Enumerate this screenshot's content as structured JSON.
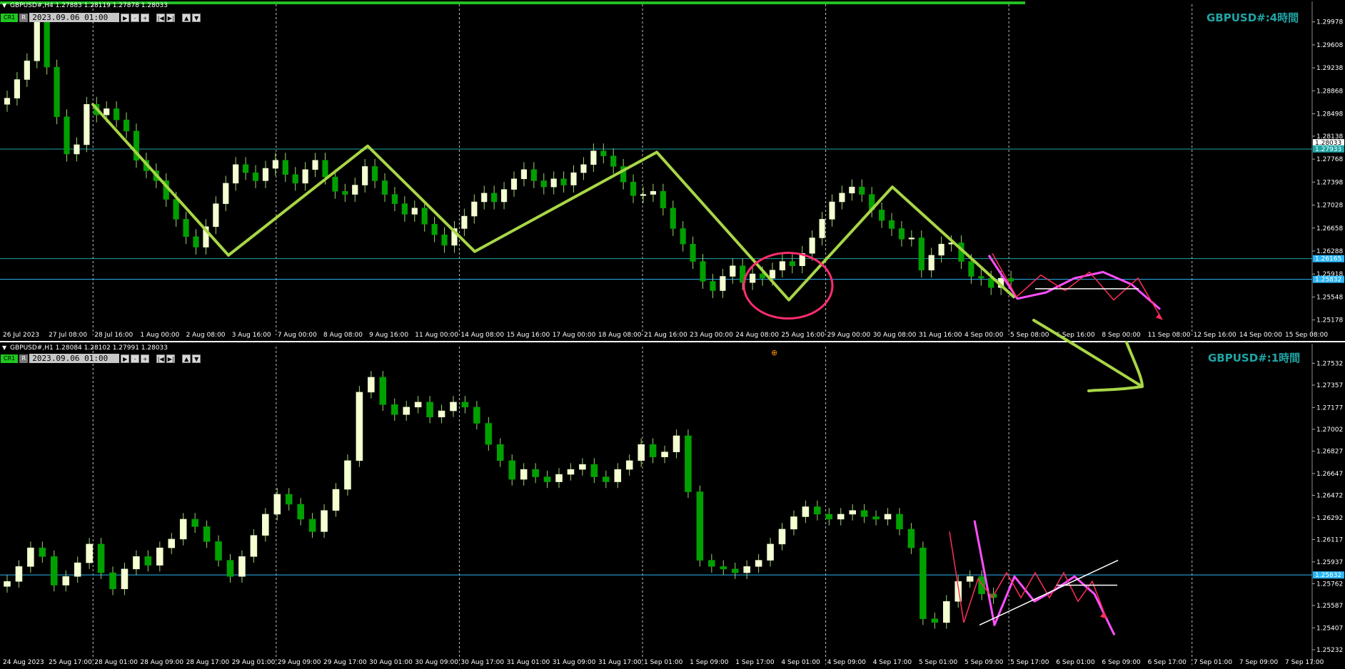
{
  "panel1": {
    "header": "GBPUSD#,H4  1.27883 1.28119 1.27878 1.28033",
    "badge": "CR1",
    "badge_r": "R",
    "datetime": "2023.09.06 01:00",
    "title": "GBPUSD#:4時間"
  },
  "panel2": {
    "header": "GBPUSD#,H1  1.28084 1.28102 1.27991 1.28033",
    "badge": "CR1",
    "badge_r": "R",
    "datetime": "2023.09.06 01:00",
    "title": "GBPUSD#:1時間"
  },
  "controls": {
    "play": "▶",
    "minus": "-",
    "plus": "+",
    "first": "|◀",
    "last": "▶|",
    "up": "▲",
    "down": "▼"
  },
  "colors": {
    "background": "#000000",
    "bull_body": "#f4ffd2",
    "bear_body": "#00a000",
    "wick": "#9bd26e",
    "wave_line": "#a8d646",
    "pink_line": "#ff4fff",
    "red_line": "#ff2d5a",
    "circle": "#ff2d6e",
    "level_line": "#1fa5a5",
    "grid": "#ffffff",
    "top_bar": "#22c022"
  },
  "chart_data": [
    {
      "type": "candlestick",
      "name": "GBPUSD#,H4",
      "timeframe": "H4",
      "x_ticks": [
        "26 Jul 2023",
        "27 Jul 08:00",
        "28 Jul 16:00",
        "1 Aug 00:00",
        "2 Aug 08:00",
        "3 Aug 16:00",
        "7 Aug 00:00",
        "8 Aug 08:00",
        "9 Aug 16:00",
        "11 Aug 00:00",
        "14 Aug 08:00",
        "15 Aug 16:00",
        "17 Aug 00:00",
        "18 Aug 08:00",
        "21 Aug 16:00",
        "23 Aug 00:00",
        "24 Aug 08:00",
        "25 Aug 16:00",
        "29 Aug 00:00",
        "30 Aug 08:00",
        "31 Aug 16:00",
        "4 Sep 00:00",
        "5 Sep 08:00",
        "6 Sep 16:00",
        "8 Sep 00:00",
        "11 Sep 08:00",
        "12 Sep 16:00",
        "14 Sep 00:00",
        "15 Sep 08:00"
      ],
      "y_ticks": [
        "1.29978",
        "1.29608",
        "1.29238",
        "1.28868",
        "1.28498",
        "1.28138",
        "1.27768",
        "1.27398",
        "1.27028",
        "1.26658",
        "1.26288",
        "1.25918",
        "1.25548",
        "1.25178"
      ],
      "ylim": [
        1.2507,
        1.3017
      ],
      "price_labels": [
        "1.28033",
        "1.27933",
        "1.26165",
        "1.25832"
      ],
      "horizontal_levels": [
        1.2793,
        1.26165,
        1.25832
      ],
      "closes": [
        1.2875,
        1.2905,
        1.2935,
        1.2998,
        1.2925,
        1.2845,
        1.2785,
        1.28,
        1.2865,
        1.2848,
        1.2858,
        1.284,
        1.2822,
        1.2775,
        1.2758,
        1.2742,
        1.2712,
        1.268,
        1.2652,
        1.2635,
        1.2668,
        1.2705,
        1.2738,
        1.2768,
        1.2755,
        1.2742,
        1.2762,
        1.2775,
        1.2752,
        1.2738,
        1.276,
        1.2775,
        1.2748,
        1.2725,
        1.272,
        1.2735,
        1.2765,
        1.2742,
        1.272,
        1.2705,
        1.2688,
        1.2698,
        1.2672,
        1.2655,
        1.2638,
        1.2665,
        1.2685,
        1.2708,
        1.2722,
        1.2708,
        1.2728,
        1.2745,
        1.276,
        1.2742,
        1.2732,
        1.2745,
        1.2735,
        1.2755,
        1.2768,
        1.279,
        1.2782,
        1.2765,
        1.274,
        1.2718,
        1.272,
        1.2725,
        1.2698,
        1.2665,
        1.264,
        1.2612,
        1.258,
        1.2565,
        1.2588,
        1.2605,
        1.2578,
        1.2592,
        1.2585,
        1.2598,
        1.2612,
        1.2605,
        1.2625,
        1.265,
        1.268,
        1.2708,
        1.2722,
        1.2732,
        1.272,
        1.2695,
        1.2678,
        1.2665,
        1.2648,
        1.265,
        1.2598,
        1.2622,
        1.264,
        1.2642,
        1.2612,
        1.2588,
        1.2585,
        1.257,
        1.2585,
        1.258
      ],
      "zigzag": [
        1.2865,
        1.2622,
        1.2798,
        1.2628,
        1.2788,
        1.255,
        1.2732,
        1.2555
      ],
      "pink_path": [
        1.2622,
        1.2552,
        1.2562,
        1.2585,
        1.2595,
        1.2575,
        1.2535
      ],
      "red_path": [
        1.2625,
        1.2555,
        1.259,
        1.2565,
        1.2595,
        1.255,
        1.2585,
        1.2518
      ],
      "flat_line": 1.2568
    },
    {
      "type": "candlestick",
      "name": "GBPUSD#,H1",
      "timeframe": "H1",
      "x_ticks": [
        "24 Aug 2023",
        "25 Aug 17:00",
        "28 Aug 01:00",
        "28 Aug 09:00",
        "28 Aug 17:00",
        "29 Aug 01:00",
        "29 Aug 09:00",
        "29 Aug 17:00",
        "30 Aug 01:00",
        "30 Aug 09:00",
        "30 Aug 17:00",
        "31 Aug 01:00",
        "31 Aug 09:00",
        "31 Aug 17:00",
        "1 Sep 01:00",
        "1 Sep 09:00",
        "1 Sep 17:00",
        "4 Sep 01:00",
        "4 Sep 09:00",
        "4 Sep 17:00",
        "5 Sep 01:00",
        "5 Sep 09:00",
        "5 Sep 17:00",
        "6 Sep 01:00",
        "6 Sep 09:00",
        "6 Sep 17:00",
        "7 Sep 01:00",
        "7 Sep 09:00",
        "7 Sep 17:00"
      ],
      "y_ticks": [
        "1.27532",
        "1.27357",
        "1.27177",
        "1.27002",
        "1.26827",
        "1.26647",
        "1.26472",
        "1.26292",
        "1.26117",
        "1.25937",
        "1.25762",
        "1.25587",
        "1.25407",
        "1.25232"
      ],
      "ylim": [
        1.2518,
        1.2762
      ],
      "price_labels": [
        "1.25832"
      ],
      "horizontal_levels": [
        1.25832
      ],
      "closes": [
        1.2578,
        1.259,
        1.2605,
        1.2598,
        1.2575,
        1.2582,
        1.2593,
        1.2608,
        1.2585,
        1.2572,
        1.2588,
        1.2598,
        1.2591,
        1.2605,
        1.2612,
        1.2628,
        1.2622,
        1.261,
        1.2595,
        1.2582,
        1.2598,
        1.2615,
        1.2632,
        1.2648,
        1.264,
        1.2628,
        1.2618,
        1.2635,
        1.2652,
        1.2675,
        1.273,
        1.2742,
        1.272,
        1.2712,
        1.2718,
        1.2722,
        1.271,
        1.2715,
        1.2722,
        1.2718,
        1.2705,
        1.2688,
        1.2675,
        1.266,
        1.2668,
        1.2662,
        1.2658,
        1.2664,
        1.2668,
        1.2672,
        1.2662,
        1.2658,
        1.2668,
        1.2675,
        1.2688,
        1.2678,
        1.2682,
        1.2695,
        1.265,
        1.2595,
        1.259,
        1.2588,
        1.2585,
        1.259,
        1.2595,
        1.2608,
        1.262,
        1.263,
        1.2638,
        1.2632,
        1.2628,
        1.2632,
        1.2635,
        1.263,
        1.2628,
        1.2632,
        1.262,
        1.2605,
        1.2548,
        1.2545,
        1.2562,
        1.2578,
        1.2582,
        1.2568,
        1.2565
      ],
      "pink_path": [
        1.2627,
        1.2543,
        1.2582,
        1.2562,
        1.2571,
        1.2582,
        1.2568,
        1.2535
      ],
      "red_path": [
        1.2618,
        1.2545,
        1.258,
        1.2565,
        1.2585,
        1.2565,
        1.2585,
        1.2565,
        1.2585,
        1.2562,
        1.2578,
        1.2548
      ],
      "trend_from": 1.2543,
      "trend_to": 1.2595,
      "flat_line": 1.2575
    }
  ]
}
